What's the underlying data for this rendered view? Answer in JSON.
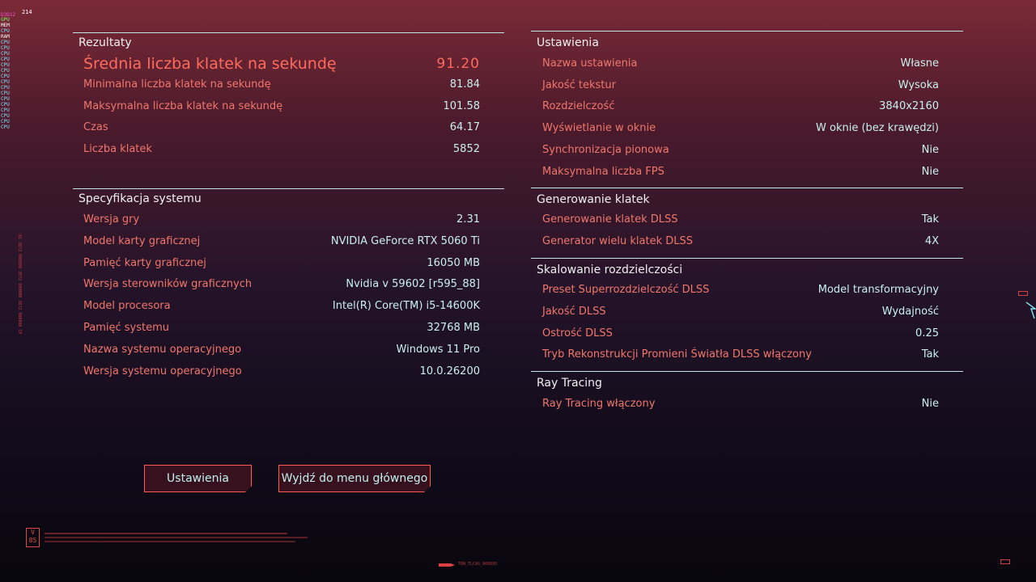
{
  "overlay": {
    "title": "D3D12",
    "fps_value": "214",
    "lines": [
      "GPU",
      "MEM",
      "CPU",
      "RAM",
      "CPU",
      "CPU",
      "CPU",
      "CPU",
      "CPU",
      "CPU",
      "CPU",
      "CPU",
      "CPU",
      "CPU",
      "CPU",
      "CPU",
      "CPU",
      "CPU",
      "CPU",
      "CPU"
    ]
  },
  "results": {
    "header": "Rezultaty",
    "avg_fps_label": "Średnia liczba klatek na sekundę",
    "avg_fps_value": "91.20",
    "rows": [
      {
        "label": "Minimalna liczba klatek na sekundę",
        "value": "81.84"
      },
      {
        "label": "Maksymalna liczba klatek na sekundę",
        "value": "101.58"
      },
      {
        "label": "Czas",
        "value": "64.17"
      },
      {
        "label": "Liczba klatek",
        "value": "5852"
      }
    ]
  },
  "system": {
    "header": "Specyfikacja systemu",
    "rows": [
      {
        "label": "Wersja gry",
        "value": "2.31"
      },
      {
        "label": "Model karty graficznej",
        "value": "NVIDIA GeForce RTX 5060 Ti"
      },
      {
        "label": "Pamięć karty graficznej",
        "value": "16050 MB"
      },
      {
        "label": "Wersja sterowników graficznych",
        "value": "Nvidia v 59602 [r595_88]"
      },
      {
        "label": "Model procesora",
        "value": "Intel(R) Core(TM) i5-14600K"
      },
      {
        "label": "Pamięć systemu",
        "value": "32768 MB"
      },
      {
        "label": "Nazwa systemu operacyjnego",
        "value": "Windows 11 Pro"
      },
      {
        "label": "Wersja systemu operacyjnego",
        "value": "10.0.26200"
      }
    ]
  },
  "settings": {
    "header": "Ustawienia",
    "rows": [
      {
        "label": "Nazwa ustawienia",
        "value": "Własne"
      },
      {
        "label": "Jakość tekstur",
        "value": "Wysoka"
      },
      {
        "label": "Rozdzielczość",
        "value": "3840x2160"
      },
      {
        "label": "Wyświetlanie w oknie",
        "value": "W oknie (bez krawędzi)"
      },
      {
        "label": "Synchronizacja pionowa",
        "value": "Nie"
      },
      {
        "label": "Maksymalna liczba FPS",
        "value": "Nie"
      }
    ]
  },
  "frame_gen": {
    "header": "Generowanie klatek",
    "rows": [
      {
        "label": "Generowanie klatek DLSS",
        "value": "Tak"
      },
      {
        "label": "Generator wielu klatek DLSS",
        "value": "4X"
      }
    ]
  },
  "scaling": {
    "header": "Skalowanie rozdzielczości",
    "rows": [
      {
        "label": "Preset Superrozdzielczość DLSS",
        "value": "Model transformacyjny"
      },
      {
        "label": "Jakość DLSS",
        "value": "Wydajność"
      },
      {
        "label": "Ostrość DLSS",
        "value": "0.25"
      },
      {
        "label": "Tryb Rekonstrukcji Promieni Światła DLSS włączony",
        "value": "Tak"
      }
    ]
  },
  "raytracing": {
    "header": "Ray Tracing",
    "rows": [
      {
        "label": "Ray Tracing włączony",
        "value": "Nie"
      }
    ]
  },
  "buttons": {
    "settings_label": "Ustawienia",
    "exit_label": "Wyjdź do menu głównego"
  },
  "footer": {
    "badge_top": "V",
    "badge_bottom": "85",
    "trn_code": "TRN_TLCAS_800095"
  },
  "colors": {
    "label": "#f0776a",
    "value": "#c8f0ee",
    "header_line": "#bfe6ea",
    "button_border": "#ff5b52"
  }
}
